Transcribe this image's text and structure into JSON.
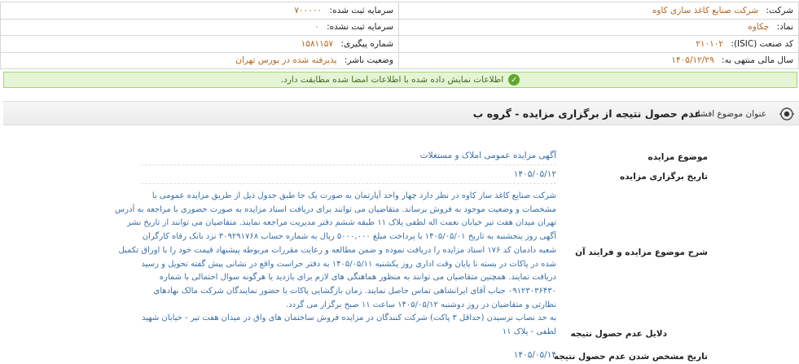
{
  "company_info": {
    "company_label": "شرکت:",
    "company_value": "شرکت صنایع کاغذ سازی کاوه",
    "capital_registered_label": "سرمایه ثبت شده:",
    "capital_registered_value": "۷۰۰۰۰۰",
    "symbol_label": "نماد:",
    "symbol_value": "چکاوه",
    "capital_unregistered_label": "سرمایه ثبت نشده:",
    "capital_unregistered_value": "۰",
    "isic_label": "کد صنعت (ISIC):",
    "isic_value": "۲۱۰۱۰۲",
    "tracking_label": "شماره پیگیری:",
    "tracking_value": "۱۵۸۱۱۵۷",
    "fiscal_year_label": "سال مالی منتهی به:",
    "fiscal_year_value": "۱۴۰۵/۱۲/۲۹",
    "publisher_status_label": "وضعیت ناشر:",
    "publisher_status_value": "پذیرفته شده در بورس تهران"
  },
  "notice": {
    "text": "اطلاعات نمایش داده شده با اطلاعات امضا شده مطابقت دارد.",
    "icon": "check-circle-icon",
    "color": "#5fa82a"
  },
  "subject": {
    "label": "عنوان موضوع افشا:",
    "title": "عدم حصول نتیجه از برگزاری مزایده - گروه ب",
    "icon": "target-icon"
  },
  "details": {
    "topic_label": "موضوع مزایده",
    "topic_value": "آگهی مزایده عمومی املاک و مستغلات",
    "date_label": "تاریخ برگزاری مزایده",
    "date_value": "۱۴۰۵/۰۵/۱۲",
    "description_label": "شرح موضوع مزایده و فرایند آن",
    "description_lines": [
      "شرکت صنایع کاغذ ساز کاوه در نظر دارد چهار واحد آپارتمان به صورت یک جا طبق جدول ذیل از طریق مزایده عمومی با",
      "مشخصات و وضعیت موجود به فروش برساند. متقاضیان می توانند برای دریافت اسناد مزایده به صورت حضوری با مراجعه به آدرس",
      "تهران میدان هفت تیر خیابان نعمت اله لطفی پلاک ۱۱ طبقه ششم دفتر مدیریت مراجعه نمایند. متقاضیان می توانند از تاریخ نشر",
      "آگهی روز پنجشنبه به تاریخ ۱۴۰۵/۰۵/۰۱ با پرداخت مبلغ ۵۰۰۰,۰۰۰ ریال به شماره حساب ۳۰۹۲۹۱۷۶۸ نزد بانک رفاه کارگران",
      "شعبه دادمان کد ۱۷۶ اسناد مزایده را دریافت نموده و ضمن مطالعه و رعایت مقررات مربوطه پیشنهاد قیمت خود را با اوراق تکمیل",
      "شده در پاکات در بسته تا پایان وقت اداری روز یکشنبه ۱۴۰۵/۰۵/۱۱ به دفتر حراست واقع در نشانی پیش گفته تحویل و رسید",
      "دریافت نمایند. همچنین متقاضیان می توانند به منظور هماهنگی های لازم برای بازدید یا هرگونه سوال احتمالی با شماره",
      "۰۹۱۲۳۰۳۶۴۳۰ جناب آقای ایرانشاهی تماس حاصل نمایند. زمان بازگشایی پاکات با حضور نمایندگان شرکت مالک نهادهای",
      "نظارتی و متقاضیان در روز دوشنبه ۱۴۰۵/۰۵/۱۲ ساعت ۱۱ صبح برگزار می گردد.",
      "به حد نصاب نرسیدن (حداقل ۳ پاکت) شرکت کنندگان در مزایده فروش ساختمان های واق در میدان هفت تیر - خیابان شهید",
      "لطفی - پلاک ۱۱"
    ],
    "reason_label": "دلایل عدم حصول نتیجه",
    "result_date_label": "تاریخ مشخص شدن عدم حصول نتیجه",
    "result_date_value": "۱۴۰۵/۰۵/۱۴"
  },
  "colors": {
    "value_orange": "#b5651d",
    "value_blue": "#3a6ea5",
    "notice_bg": "#e6f4d6"
  }
}
